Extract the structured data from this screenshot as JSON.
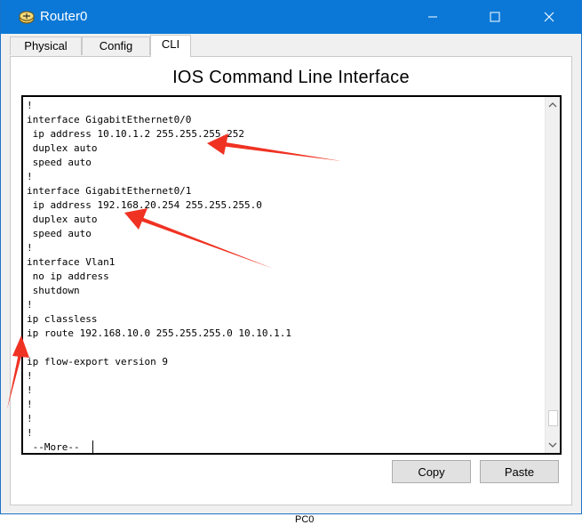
{
  "window": {
    "title": "Router0"
  },
  "tabs": [
    {
      "label": "Physical",
      "active": false
    },
    {
      "label": "Config",
      "active": false
    },
    {
      "label": "CLI",
      "active": true
    }
  ],
  "cli": {
    "heading": "IOS Command Line Interface",
    "lines": [
      "!",
      "interface GigabitEthernet0/0",
      " ip address 10.10.1.2 255.255.255.252",
      " duplex auto",
      " speed auto",
      "!",
      "interface GigabitEthernet0/1",
      " ip address 192.168.20.254 255.255.255.0",
      " duplex auto",
      " speed auto",
      "!",
      "interface Vlan1",
      " no ip address",
      " shutdown",
      "!",
      "ip classless",
      "ip route 192.168.10.0 255.255.255.0 10.10.1.1",
      "",
      "ip flow-export version 9",
      "!",
      "!",
      "!",
      "!",
      "!"
    ],
    "more_prompt": " --More-- ",
    "scroll_position": 0.95
  },
  "buttons": {
    "copy": "Copy",
    "paste": "Paste"
  },
  "background": {
    "partial_label": "PC0"
  },
  "colors": {
    "titlebar": "#0b78d7",
    "annotation_arrow": "#f03223"
  }
}
